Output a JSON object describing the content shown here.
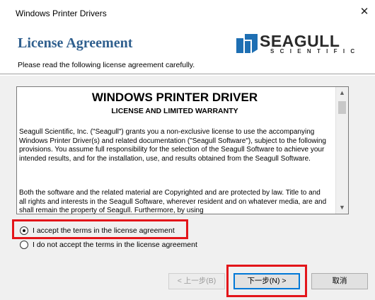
{
  "window": {
    "title": "Windows Printer Drivers",
    "close_glyph": "✕"
  },
  "header": {
    "heading": "License Agreement",
    "subheading": "Please read the following license agreement carefully."
  },
  "logo": {
    "brand": "SEAGULL",
    "sub": "SCIENTIFIC",
    "brand_color": "#1e6fb3"
  },
  "license": {
    "title": "WINDOWS PRINTER DRIVER",
    "subtitle": "LICENSE AND LIMITED WARRANTY",
    "paragraph1": "Seagull Scientific, Inc. (\"Seagull\") grants you a non-exclusive license to use the accompanying Windows Printer Driver(s) and related documentation (\"Seagull Software\"), subject to the following provisions.  You assume full responsibility for the selection of the Seagull Software to achieve your intended results, and for the installation, use, and results obtained from the Seagull Software.",
    "paragraph2": "Both the software and the related material are Copyrighted and are protected by law. Title to and all rights and interests in the Seagull Software, wherever resident and on whatever media, are and shall remain the property of Seagull.  Furthermore, by using"
  },
  "options": {
    "accept_label": "I accept the terms in the license agreement",
    "decline_label": "I do not accept the terms in the license agreement",
    "selected": "accept"
  },
  "buttons": {
    "back": "< 上一步(B)",
    "next": "下一步(N) >",
    "cancel": "取消"
  },
  "colors": {
    "heading": "#2f5f8e",
    "highlight": "#e3151a",
    "focus": "#0078d7"
  }
}
